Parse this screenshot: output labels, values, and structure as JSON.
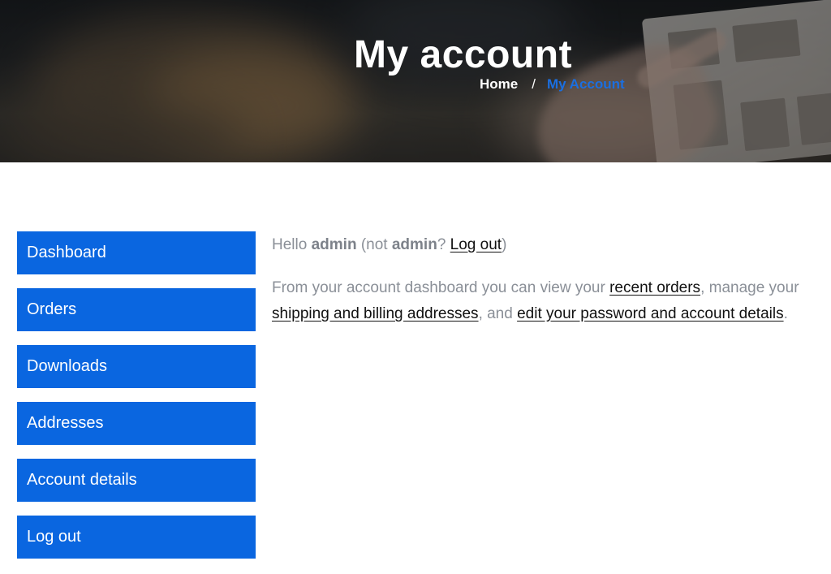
{
  "hero": {
    "title": "My account",
    "breadcrumb": {
      "home": "Home",
      "separator": "/",
      "current": "My Account"
    }
  },
  "nav": {
    "items": [
      {
        "label": "Dashboard"
      },
      {
        "label": "Orders"
      },
      {
        "label": "Downloads"
      },
      {
        "label": "Addresses"
      },
      {
        "label": "Account details"
      },
      {
        "label": "Log out"
      }
    ]
  },
  "greeting": {
    "hello": "Hello",
    "username": "admin",
    "not_prefix": "(not",
    "not_username": "admin",
    "question": "?",
    "logout_link": "Log out",
    "close_paren": ")"
  },
  "intro": {
    "text_1": "From your account dashboard you can view your",
    "link_orders": "recent orders",
    "text_2": ", manage your",
    "link_addresses": "shipping and billing addresses",
    "text_3": ", and",
    "link_account": "edit your password and account details",
    "text_4": "."
  },
  "colors": {
    "accent": "#0a66e0",
    "breadcrumb_active": "#1b6fe0",
    "body_text": "#8a8f97",
    "link_text": "#111111"
  }
}
